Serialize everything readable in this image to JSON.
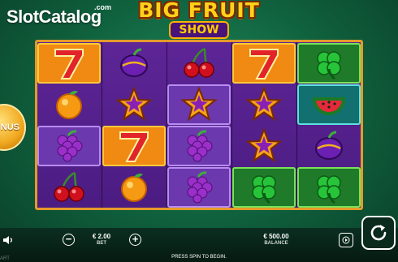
{
  "watermark": {
    "brand": "SlotCatalog",
    "domain": ".com"
  },
  "logo": {
    "line1": "BIG FRUIT",
    "line2": "SHOW"
  },
  "bonus": {
    "label": "NUS"
  },
  "grid": {
    "columns": 5,
    "rows": 4,
    "reels": [
      [
        "seven",
        "orange",
        "grapes",
        "cherry"
      ],
      [
        "plum",
        "star",
        "seven",
        "orange"
      ],
      [
        "cherry",
        "star",
        "grapes",
        "grapes"
      ],
      [
        "seven",
        "star",
        "star",
        "clover"
      ],
      [
        "clover",
        "watermelon",
        "plum",
        "clover"
      ]
    ],
    "highlights": {
      "purple": [
        "r0c2",
        "r2c1",
        "r2c2",
        "r2c3"
      ],
      "green": [
        "r4c0",
        "r3c3",
        "r4c3"
      ],
      "teal": [
        "r4c1"
      ],
      "orange": [
        "r0c0",
        "r1c2",
        "r3c0"
      ]
    }
  },
  "footer": {
    "bet_value": "€ 2.00",
    "bet_label": "BET",
    "balance_value": "€ 500.00",
    "balance_label": "BALANCE",
    "message": "PRESS SPIN TO BEGIN.",
    "edge_text": "ART"
  },
  "icons": {
    "speaker": "speaker-icon",
    "minus": "minus-icon",
    "plus": "plus-icon",
    "autoplay": "autoplay-icon",
    "spin": "spin-icon"
  },
  "colors": {
    "background": "#0f5e3c",
    "reel_bg": "#4b1c82",
    "frame_gold": "#e49a2a"
  }
}
